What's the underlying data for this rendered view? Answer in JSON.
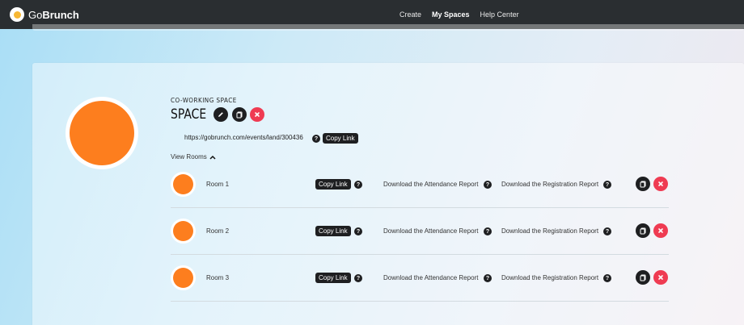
{
  "brand": {
    "prefix": "Go",
    "bold": "Brunch"
  },
  "nav": {
    "create": "Create",
    "my_spaces": "My Spaces",
    "help_center": "Help Center"
  },
  "space": {
    "type": "CO-WORKING SPACE",
    "name": "SPACE",
    "url": "https://gobrunch.com/events/land/300436",
    "copy_link": "Copy Link",
    "view_rooms": "View Rooms",
    "avatar_color": "#fd7e1e"
  },
  "rooms": [
    {
      "name": "Room 1",
      "copy_link": "Copy Link",
      "attendance": "Download the Attendance Report",
      "registration": "Download the Registration Report"
    },
    {
      "name": "Room 2",
      "copy_link": "Copy Link",
      "attendance": "Download the Attendance Report",
      "registration": "Download the Registration Report"
    },
    {
      "name": "Room 3",
      "copy_link": "Copy Link",
      "attendance": "Download the Attendance Report",
      "registration": "Download the Registration Report"
    }
  ],
  "icons": {
    "help": "?",
    "edit": "pencil-icon",
    "copy": "copy-icon",
    "delete": "x-icon",
    "expand": "chevron-up-icon"
  },
  "colors": {
    "navbar": "#2a2e31",
    "accent_orange": "#fd7e1e",
    "delete_red": "#ef3b52",
    "dark_button": "#1e1f21"
  }
}
